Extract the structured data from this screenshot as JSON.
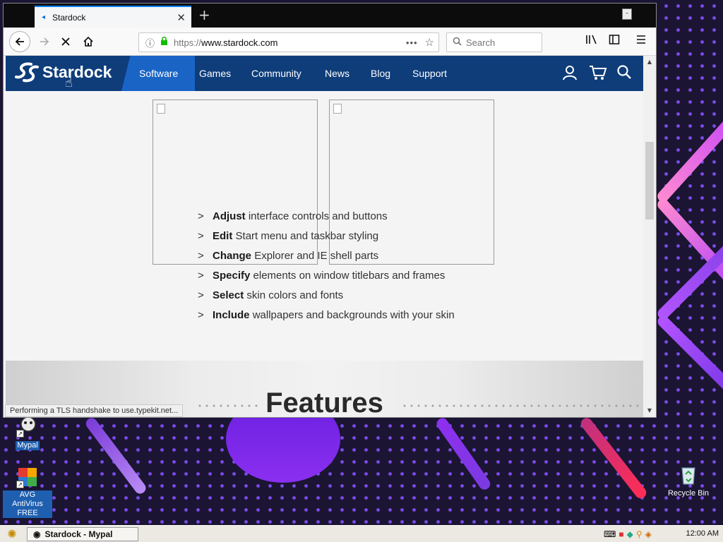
{
  "browser": {
    "tab": {
      "title": "Stardock"
    },
    "url": {
      "protocol": "https://",
      "host": "www.stardock.com"
    },
    "search_placeholder": "Search",
    "status": "Performing a TLS handshake to use.typekit.net..."
  },
  "site": {
    "logo": "Stardock",
    "nav": [
      "Software",
      "Games",
      "Community",
      "News",
      "Blog",
      "Support"
    ],
    "features": [
      {
        "bold": "Adjust",
        "rest": "interface controls and buttons"
      },
      {
        "bold": "Edit",
        "rest": "Start menu and taskbar styling"
      },
      {
        "bold": "Change",
        "rest": "Explorer and IE shell parts"
      },
      {
        "bold": "Specify",
        "rest": "elements on window titlebars and frames"
      },
      {
        "bold": "Select",
        "rest": "skin colors and fonts"
      },
      {
        "bold": "Include",
        "rest": "wallpapers and backgrounds with your skin"
      }
    ],
    "features_heading": "Features",
    "accent_color": "#0e3d7a",
    "active_nav_color": "#1a64c6"
  },
  "desktop": {
    "icons": [
      "Mypal",
      "AVG AntiVirus FREE",
      "Recycle Bin"
    ]
  },
  "taskbar": {
    "task": "Stardock - Mypal",
    "clock": "12:00 AM"
  }
}
